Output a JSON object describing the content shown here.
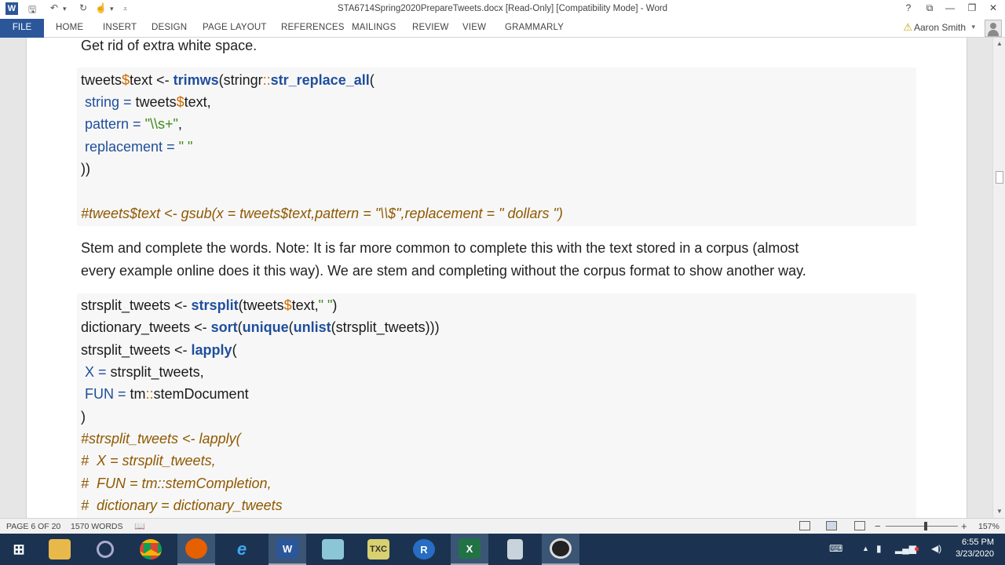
{
  "window": {
    "title": "STA6714Spring2020PrepareTweets.docx [Read-Only] [Compatibility Mode] - Word",
    "help": "?",
    "restore_ribbon": "⧉",
    "minimize": "—",
    "maximize": "❐",
    "close": "✕"
  },
  "ribbon": {
    "file": "FILE",
    "tabs": [
      "HOME",
      "INSERT",
      "DESIGN",
      "PAGE LAYOUT",
      "REFERENCES",
      "MAILINGS",
      "REVIEW",
      "VIEW",
      "GRAMMARLY"
    ],
    "user": "Aaron Smith"
  },
  "document": {
    "line1": "Get rid of extra white space.",
    "code1": {
      "l1": {
        "a": "tweets",
        "b": "$",
        "c": "text <- ",
        "d": "trimws",
        "e": "(stringr",
        "f": "::",
        "g": "str_replace_all",
        "h": "("
      },
      "l2": {
        "a": " string",
        "b": " = ",
        "c": "tweets",
        "d": "$",
        "e": "text,"
      },
      "l3": {
        "a": " pattern",
        "b": " = ",
        "c": "\"\\\\s+\"",
        "d": ","
      },
      "l4": {
        "a": " replacement",
        "b": " = ",
        "c": "\" \""
      },
      "l5": "))",
      "l6": "#tweets$text <- gsub(x = tweets$text,pattern = \"\\\\$\",replacement = \" dollars \")"
    },
    "para1_line1": "Stem and complete the words. Note: It is far more common to complete this with the text stored in a corpus (almost",
    "para1_line2": "every example online does it this way). We are stem and completing without the corpus format to show another way.",
    "code2": {
      "l1": {
        "a": "strsplit_tweets <- ",
        "b": "strsplit",
        "c": "(tweets",
        "d": "$",
        "e": "text,",
        "f": "\" \"",
        "g": ")"
      },
      "l2": {
        "a": "dictionary_tweets <- ",
        "b": "sort",
        "c": "(",
        "d": "unique",
        "e": "(",
        "f": "unlist",
        "g": "(strsplit_tweets)))"
      },
      "l3": {
        "a": "strsplit_tweets <- ",
        "b": "lapply",
        "c": "("
      },
      "l4": {
        "a": " X",
        "b": " = ",
        "c": "strsplit_tweets,"
      },
      "l5": {
        "a": " FUN",
        "b": " = ",
        "c": "tm",
        "d": "::",
        "e": "stemDocument"
      },
      "l6": ")",
      "l7": "#strsplit_tweets <- lapply(",
      "l8": "#  X = strsplit_tweets,",
      "l9": "#  FUN = tm::stemCompletion,",
      "l10": "#  dictionary = dictionary_tweets"
    }
  },
  "status": {
    "page": "PAGE 6 OF 20",
    "words": "1570 WORDS",
    "zoom": "157%",
    "zoom_minus": "−",
    "zoom_plus": "+"
  },
  "taskbar": {
    "time": "6:55 PM",
    "date": "3/23/2020",
    "apps": [
      "start-icon",
      "file-explorer-icon",
      "search-icon",
      "chrome-icon",
      "firefox-icon",
      "internet-explorer-icon",
      "word-icon",
      "notepad-icon",
      "texstudio-icon",
      "r-icon",
      "excel-icon",
      "recycle-bin-icon",
      "obs-icon"
    ]
  },
  "colors": {
    "word_blue": "#2b579a",
    "taskbar": "#1b3350",
    "code_keyword": "#1f4e9c",
    "code_operator": "#ce6a00",
    "code_string": "#3f8a1f",
    "code_comment": "#8f5902"
  }
}
